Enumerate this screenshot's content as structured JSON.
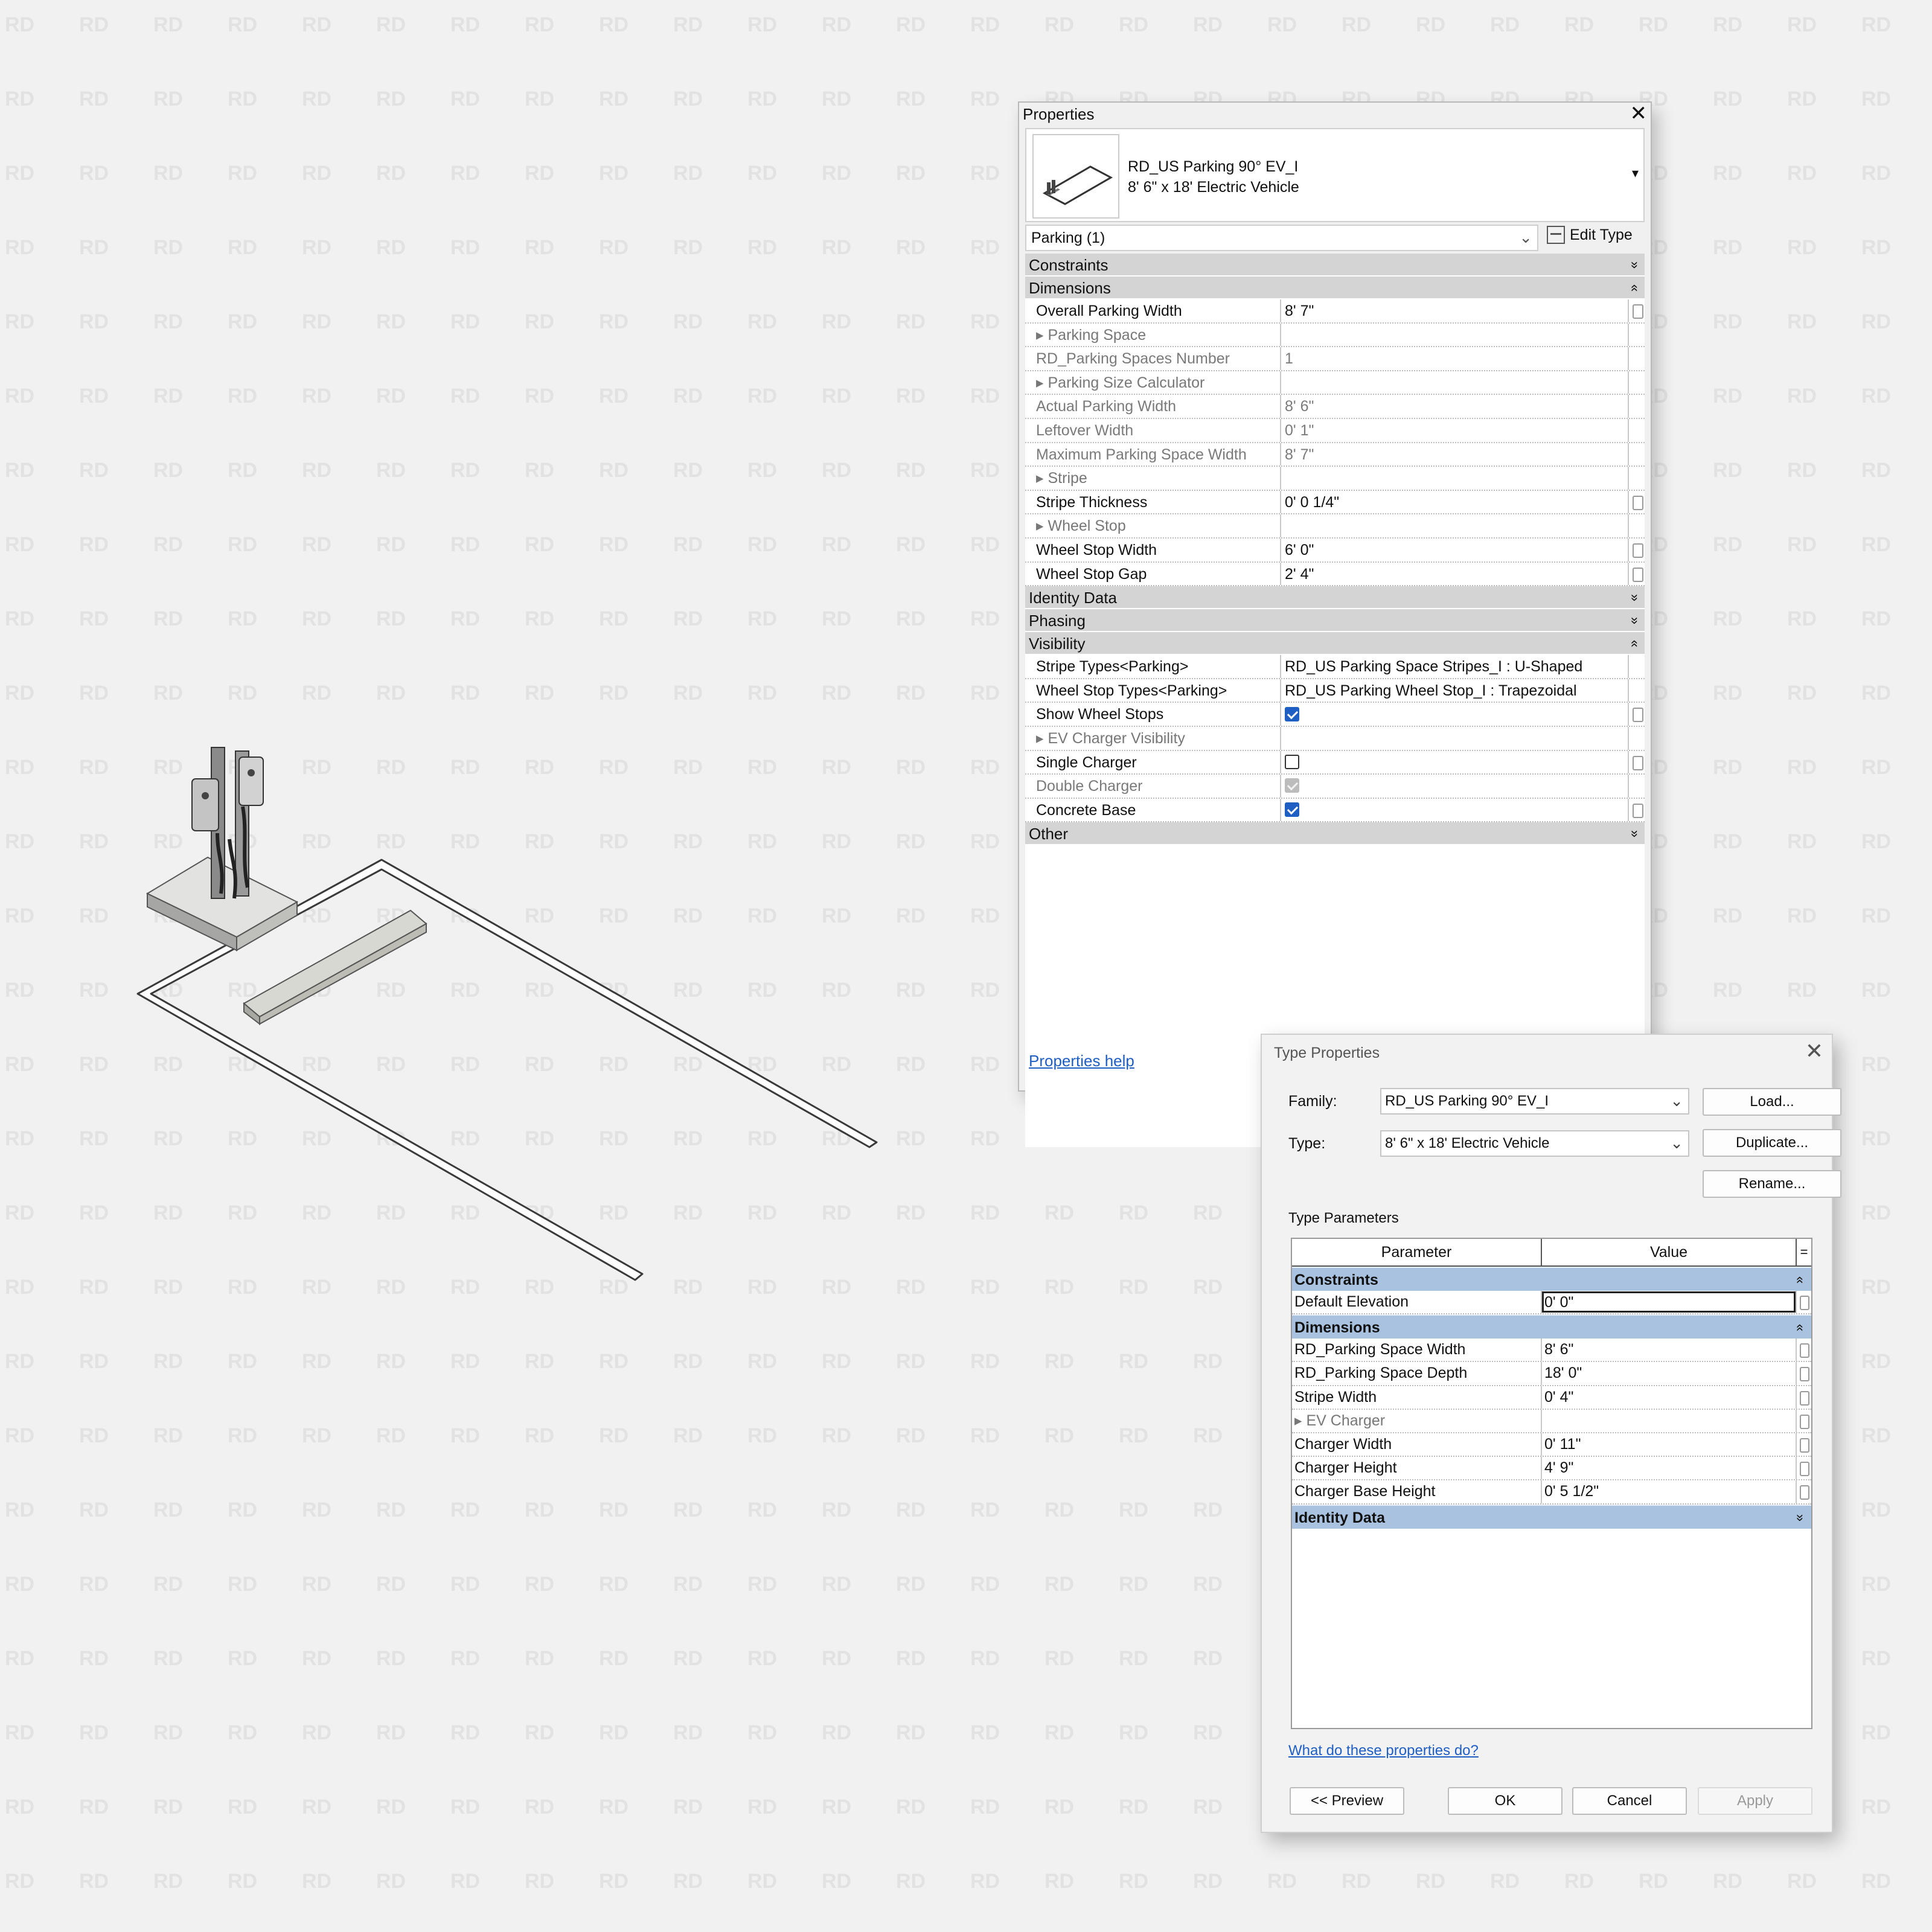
{
  "colors": {
    "accent": "#1f5fc4",
    "type_group_bg": "#a9c2df",
    "prop_group_bg": "#d4d4d4"
  },
  "watermark": "RD",
  "properties": {
    "title": "Properties",
    "close_icon": "close-icon",
    "type_name_line1": "RD_US Parking 90° EV_I",
    "type_name_line2": "8' 6\" x 18' Electric Vehicle",
    "instance_filter": "Parking (1)",
    "edit_type_label": "Edit Type",
    "help_link": "Properties help",
    "groups": [
      {
        "name": "Constraints",
        "toggle": "»",
        "rows": []
      },
      {
        "name": "Dimensions",
        "toggle": "«",
        "rows": [
          {
            "name": "Overall Parking Width",
            "value": "8'  7\"",
            "style": "normal",
            "edit": true
          },
          {
            "name": "▸ Parking Space",
            "value": "",
            "style": "sub",
            "edit": false
          },
          {
            "name": "RD_Parking Spaces Number",
            "value": "1",
            "style": "dim",
            "edit": false
          },
          {
            "name": "▸ Parking Size Calculator",
            "value": "",
            "style": "sub",
            "edit": false
          },
          {
            "name": "Actual Parking Width",
            "value": "8'  6\"",
            "style": "dim",
            "edit": false
          },
          {
            "name": "Leftover Width",
            "value": "0'  1\"",
            "style": "dim",
            "edit": false
          },
          {
            "name": "Maximum Parking Space Width",
            "value": "8'  7\"",
            "style": "dim",
            "edit": false
          },
          {
            "name": "▸ Stripe",
            "value": "",
            "style": "sub",
            "edit": false
          },
          {
            "name": "Stripe Thickness",
            "value": "0'  0 1/4\"",
            "style": "normal",
            "edit": true
          },
          {
            "name": "▸ Wheel Stop",
            "value": "",
            "style": "sub",
            "edit": false
          },
          {
            "name": "Wheel Stop Width",
            "value": "6'  0\"",
            "style": "normal",
            "edit": true
          },
          {
            "name": "Wheel Stop Gap",
            "value": "2'  4\"",
            "style": "normal",
            "edit": true
          }
        ]
      },
      {
        "name": "Identity Data",
        "toggle": "»",
        "rows": []
      },
      {
        "name": "Phasing",
        "toggle": "»",
        "rows": []
      },
      {
        "name": "Visibility",
        "toggle": "«",
        "rows": [
          {
            "name": "Stripe Types<Parking>",
            "value": "RD_US Parking Space Stripes_I : U-Shaped",
            "style": "normal",
            "edit": false
          },
          {
            "name": "Wheel Stop Types<Parking>",
            "value": "RD_US Parking Wheel Stop_I : Trapezoidal",
            "style": "normal",
            "edit": false
          },
          {
            "name": "Show Wheel Stops",
            "check": "checked",
            "style": "normal",
            "edit": true
          },
          {
            "name": "▸ EV Charger Visibility",
            "value": "",
            "style": "sub",
            "edit": false
          },
          {
            "name": "Single Charger",
            "check": "unchecked",
            "style": "normal",
            "edit": true
          },
          {
            "name": "Double Charger",
            "check": "disabled",
            "style": "dim",
            "edit": false
          },
          {
            "name": "Concrete Base",
            "check": "checked",
            "style": "normal",
            "edit": true
          }
        ]
      },
      {
        "name": "Other",
        "toggle": "»",
        "rows": []
      }
    ]
  },
  "type_properties": {
    "title": "Type Properties",
    "family_label": "Family:",
    "family_value": "RD_US Parking 90° EV_I",
    "type_label": "Type:",
    "type_value": "8' 6\" x 18' Electric Vehicle",
    "buttons": {
      "load": "Load...",
      "duplicate": "Duplicate...",
      "rename": "Rename..."
    },
    "section_label": "Type Parameters",
    "col_parameter": "Parameter",
    "col_value": "Value",
    "col_eq": "=",
    "groups": [
      {
        "name": "Constraints",
        "toggle": "«",
        "rows": [
          {
            "name": "Default Elevation",
            "value": "0'  0\"",
            "active": true
          }
        ]
      },
      {
        "name": "Dimensions",
        "toggle": "«",
        "rows": [
          {
            "name": "RD_Parking Space Width",
            "value": "8'  6\""
          },
          {
            "name": "RD_Parking Space Depth",
            "value": "18'  0\""
          },
          {
            "name": "Stripe Width",
            "value": "0'  4\""
          },
          {
            "name": "▸ EV Charger",
            "value": "",
            "sub": true
          },
          {
            "name": "Charger Width",
            "value": "0'  11\""
          },
          {
            "name": "Charger Height",
            "value": "4'  9\""
          },
          {
            "name": "Charger Base Height",
            "value": "0'  5 1/2\""
          }
        ]
      },
      {
        "name": "Identity Data",
        "toggle": "»",
        "rows": []
      }
    ],
    "help_link": "What do these properties do?",
    "footer": {
      "preview": "<< Preview",
      "ok": "OK",
      "cancel": "Cancel",
      "apply": "Apply"
    }
  }
}
